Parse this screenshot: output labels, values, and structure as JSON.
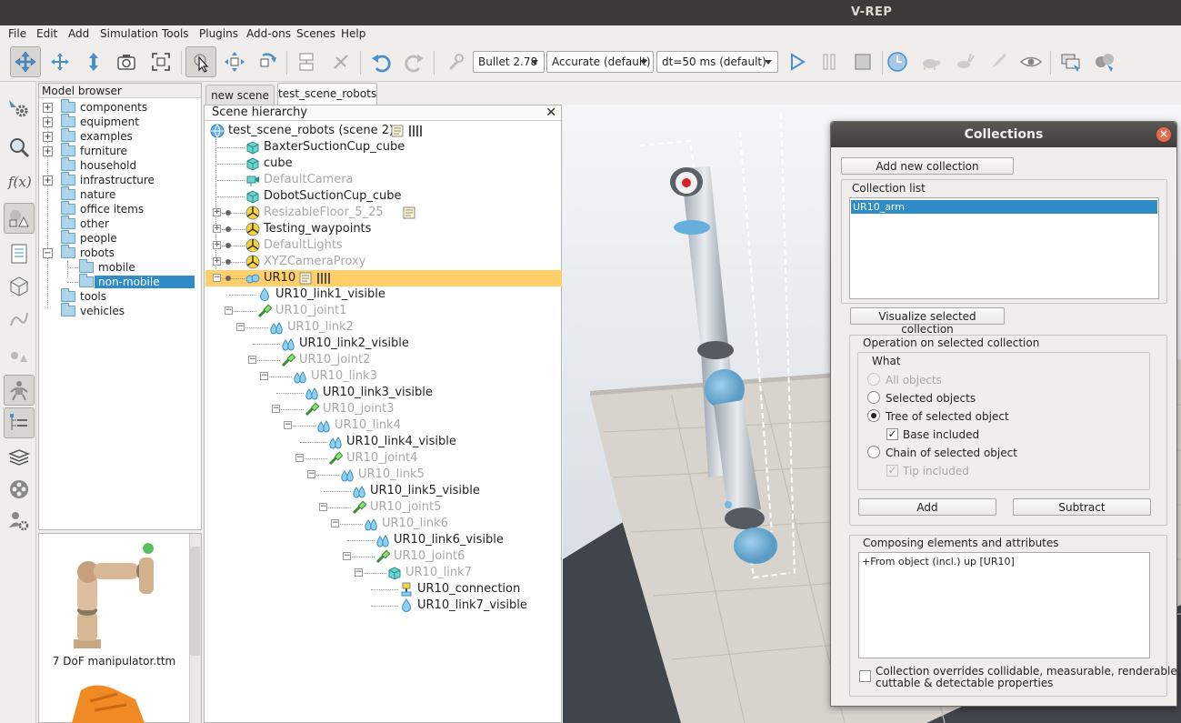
{
  "window": {
    "title": "V-REP"
  },
  "menu": [
    "File",
    "Edit",
    "Add",
    "Simulation",
    "Tools",
    "Plugins",
    "Add-ons",
    "Scenes",
    "Help"
  ],
  "toolbar": {
    "engine": "Bullet 2.78",
    "accuracy": "Accurate (default)",
    "timestep": "dt=50 ms (default)"
  },
  "model_browser": {
    "title": "Model browser",
    "items": [
      {
        "label": "components",
        "expandable": true
      },
      {
        "label": "equipment",
        "expandable": true
      },
      {
        "label": "examples",
        "expandable": true
      },
      {
        "label": "furniture",
        "expandable": true
      },
      {
        "label": "household",
        "expandable": false
      },
      {
        "label": "infrastructure",
        "expandable": true
      },
      {
        "label": "nature",
        "expandable": false
      },
      {
        "label": "office items",
        "expandable": false
      },
      {
        "label": "other",
        "expandable": false
      },
      {
        "label": "people",
        "expandable": false
      },
      {
        "label": "robots",
        "expandable": true
      },
      {
        "label": "mobile",
        "expandable": false
      },
      {
        "label": "non-mobile",
        "expandable": false
      },
      {
        "label": "tools",
        "expandable": false
      },
      {
        "label": "vehicles",
        "expandable": false
      }
    ],
    "thumbnail_caption": "7 DoF manipulator.ttm"
  },
  "tabs": [
    "new scene",
    "test_scene_robots"
  ],
  "hierarchy": {
    "title": "Scene hierarchy",
    "root": "test_scene_robots (scene 2)",
    "items": [
      {
        "label": "BaxterSuctionCup_cube",
        "dim": false
      },
      {
        "label": "cube",
        "dim": false
      },
      {
        "label": "DefaultCamera",
        "dim": true
      },
      {
        "label": "DobotSuctionCup_cube",
        "dim": false
      },
      {
        "label": "ResizableFloor_5_25",
        "dim": true
      },
      {
        "label": "Testing_waypoints",
        "dim": false
      },
      {
        "label": "DefaultLights",
        "dim": true
      },
      {
        "label": "XYZCameraProxy",
        "dim": true
      },
      {
        "label": "UR10",
        "dim": false
      },
      {
        "label": "UR10_link1_visible",
        "dim": false
      },
      {
        "label": "UR10_joint1",
        "dim": true
      },
      {
        "label": "UR10_link2",
        "dim": true
      },
      {
        "label": "UR10_link2_visible",
        "dim": false
      },
      {
        "label": "UR10_joint2",
        "dim": true
      },
      {
        "label": "UR10_link3",
        "dim": true
      },
      {
        "label": "UR10_link3_visible",
        "dim": false
      },
      {
        "label": "UR10_joint3",
        "dim": true
      },
      {
        "label": "UR10_link4",
        "dim": true
      },
      {
        "label": "UR10_link4_visible",
        "dim": false
      },
      {
        "label": "UR10_joint4",
        "dim": true
      },
      {
        "label": "UR10_link5",
        "dim": true
      },
      {
        "label": "UR10_link5_visible",
        "dim": false
      },
      {
        "label": "UR10_joint5",
        "dim": true
      },
      {
        "label": "UR10_link6",
        "dim": true
      },
      {
        "label": "UR10_link6_visible",
        "dim": false
      },
      {
        "label": "UR10_joint6",
        "dim": true
      },
      {
        "label": "UR10_link7",
        "dim": true
      },
      {
        "label": "UR10_connection",
        "dim": false
      },
      {
        "label": "UR10_link7_visible",
        "dim": false
      }
    ]
  },
  "collections": {
    "title": "Collections",
    "add_new_label": "Add new collection",
    "list_label": "Collection list",
    "list_items": [
      "UR10_arm"
    ],
    "visualize_label": "Visualize selected collection",
    "operation_label": "Operation on selected collection",
    "what_label": "What",
    "options": {
      "all_objects": "All objects",
      "selected_objects": "Selected objects",
      "tree_selected": "Tree of selected object",
      "base_included": "Base included",
      "chain_selected": "Chain of selected object",
      "tip_included": "Tip included"
    },
    "add_label": "Add",
    "subtract_label": "Subtract",
    "composing_label": "Composing elements and attributes",
    "composing_text": "+From object (incl.) up [UR10]",
    "override_line1": "Collection overrides collidable, measurable, renderable,",
    "override_line2": "cuttable & detectable properties"
  }
}
